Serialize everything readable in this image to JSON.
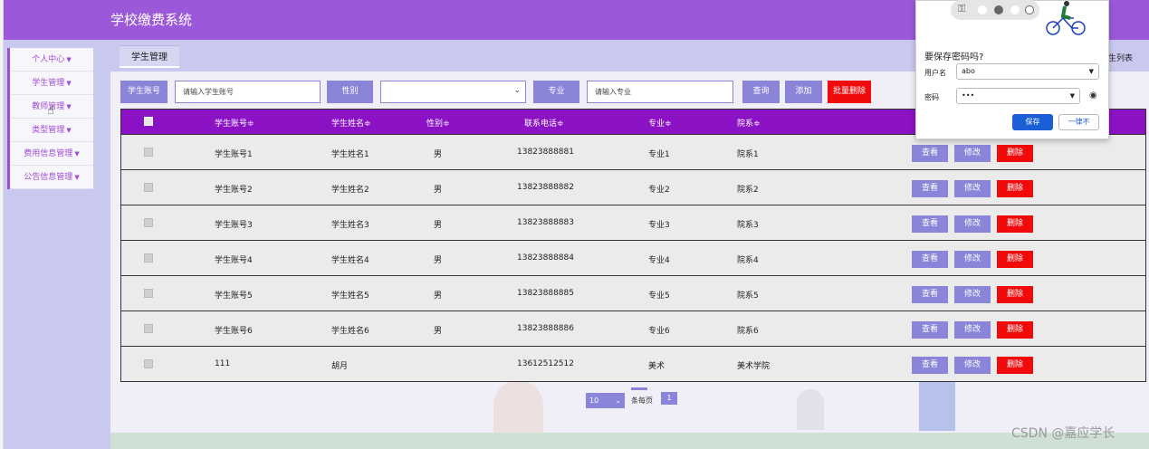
{
  "app": {
    "title": "学校缴费系统"
  },
  "sidebar": {
    "items": [
      {
        "label": "个人中心"
      },
      {
        "label": "学生管理"
      },
      {
        "label": "教师管理"
      },
      {
        "label": "类型管理"
      },
      {
        "label": "费用信息管理"
      },
      {
        "label": "公告信息管理"
      }
    ]
  },
  "tabs": {
    "active": "学生管理",
    "right_crumb": "生列表"
  },
  "search": {
    "account_label": "学生账号",
    "account_placeholder": "请输入学生账号",
    "gender_label": "性别",
    "gender_value": "",
    "major_label": "专业",
    "major_placeholder": "请输入专业",
    "query": "查询",
    "add": "添加",
    "batch_delete": "批量删除"
  },
  "table": {
    "headers": [
      "学生账号≑",
      "学生姓名≑",
      "性别≑",
      "联系电话≑",
      "专业≑",
      "院系≑"
    ],
    "rows": [
      {
        "account": "学生账号1",
        "name": "学生姓名1",
        "gender": "男",
        "phone": "13823888881",
        "major": "专业1",
        "dept": "院系1"
      },
      {
        "account": "学生账号2",
        "name": "学生姓名2",
        "gender": "男",
        "phone": "13823888882",
        "major": "专业2",
        "dept": "院系2"
      },
      {
        "account": "学生账号3",
        "name": "学生姓名3",
        "gender": "男",
        "phone": "13823888883",
        "major": "专业3",
        "dept": "院系3"
      },
      {
        "account": "学生账号4",
        "name": "学生姓名4",
        "gender": "男",
        "phone": "13823888884",
        "major": "专业4",
        "dept": "院系4"
      },
      {
        "account": "学生账号5",
        "name": "学生姓名5",
        "gender": "男",
        "phone": "13823888885",
        "major": "专业5",
        "dept": "院系5"
      },
      {
        "account": "学生账号6",
        "name": "学生姓名6",
        "gender": "男",
        "phone": "13823888886",
        "major": "专业6",
        "dept": "院系6"
      },
      {
        "account": "111",
        "name": "胡月",
        "gender": "",
        "phone": "13612512512",
        "major": "美术",
        "dept": "美术学院"
      }
    ],
    "actions": {
      "view": "查看",
      "edit": "修改",
      "delete": "删除"
    }
  },
  "pagination": {
    "page_size": "10",
    "per_page_text": "条每页",
    "current": "1"
  },
  "password_popup": {
    "title": "要保存密码吗?",
    "username_label": "用户名",
    "username_value": "abo",
    "password_label": "密码",
    "password_value": "•••",
    "save": "保存",
    "never": "一律不"
  },
  "watermark": "CSDN @嘉应学长",
  "colors": {
    "header": "#9b59d9",
    "accent": "#8a85d8",
    "table_header": "#8a12c4",
    "danger": "#f00a0a"
  }
}
